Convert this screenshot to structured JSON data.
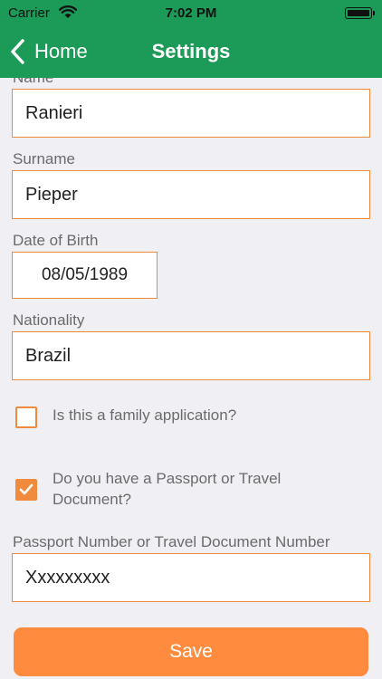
{
  "status_bar": {
    "carrier": "Carrier",
    "time": "7:02 PM"
  },
  "nav": {
    "back_label": "Home",
    "title": "Settings"
  },
  "form": {
    "name_label": "Name",
    "name_value": "Ranieri",
    "surname_label": "Surname",
    "surname_value": "Pieper",
    "dob_label": "Date of Birth",
    "dob_value": "08/05/1989",
    "nationality_label": "Nationality",
    "nationality_value": "Brazil",
    "family_question": "Is this a family application?",
    "family_checked": false,
    "passport_question": "Do you have a Passport or Travel Document?",
    "passport_checked": true,
    "passport_number_label": "Passport Number or Travel Document Number",
    "passport_number_value": "Xxxxxxxxx"
  },
  "save_label": "Save",
  "colors": {
    "header": "#1c9a58",
    "accent": "#f08a3c",
    "button": "#ff8c3e",
    "background": "#efeff4"
  }
}
